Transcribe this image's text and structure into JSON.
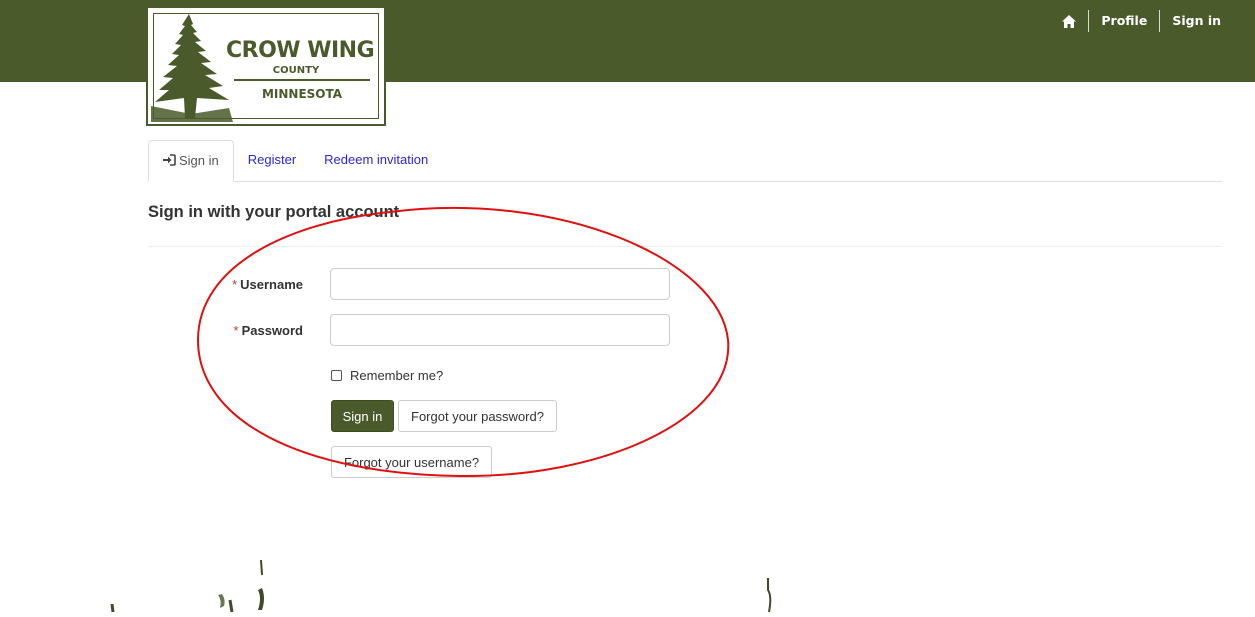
{
  "colors": {
    "brand_green": "#4a5a2b",
    "link_blue": "#2a27d6",
    "required_red": "#c0392b",
    "annotation_red": "#e01010"
  },
  "header": {
    "home_icon": "home-icon",
    "nav": {
      "profile": "Profile",
      "sign_in": "Sign in"
    }
  },
  "logo": {
    "line1": "CROW WING",
    "line2": "COUNTY",
    "line3": "MINNESOTA"
  },
  "tabs": [
    {
      "label": "Sign in",
      "active": true,
      "icon": "sign-in-icon"
    },
    {
      "label": "Register",
      "active": false
    },
    {
      "label": "Redeem invitation",
      "active": false
    }
  ],
  "form": {
    "title": "Sign in with your portal account",
    "username_label": "Username",
    "username_value": "",
    "password_label": "Password",
    "password_value": "",
    "required_marker": "*",
    "remember_label": "Remember me?",
    "remember_checked": false,
    "sign_in_button": "Sign in",
    "forgot_password_button": "Forgot your password?",
    "forgot_username_button": "Forgot your username?"
  }
}
